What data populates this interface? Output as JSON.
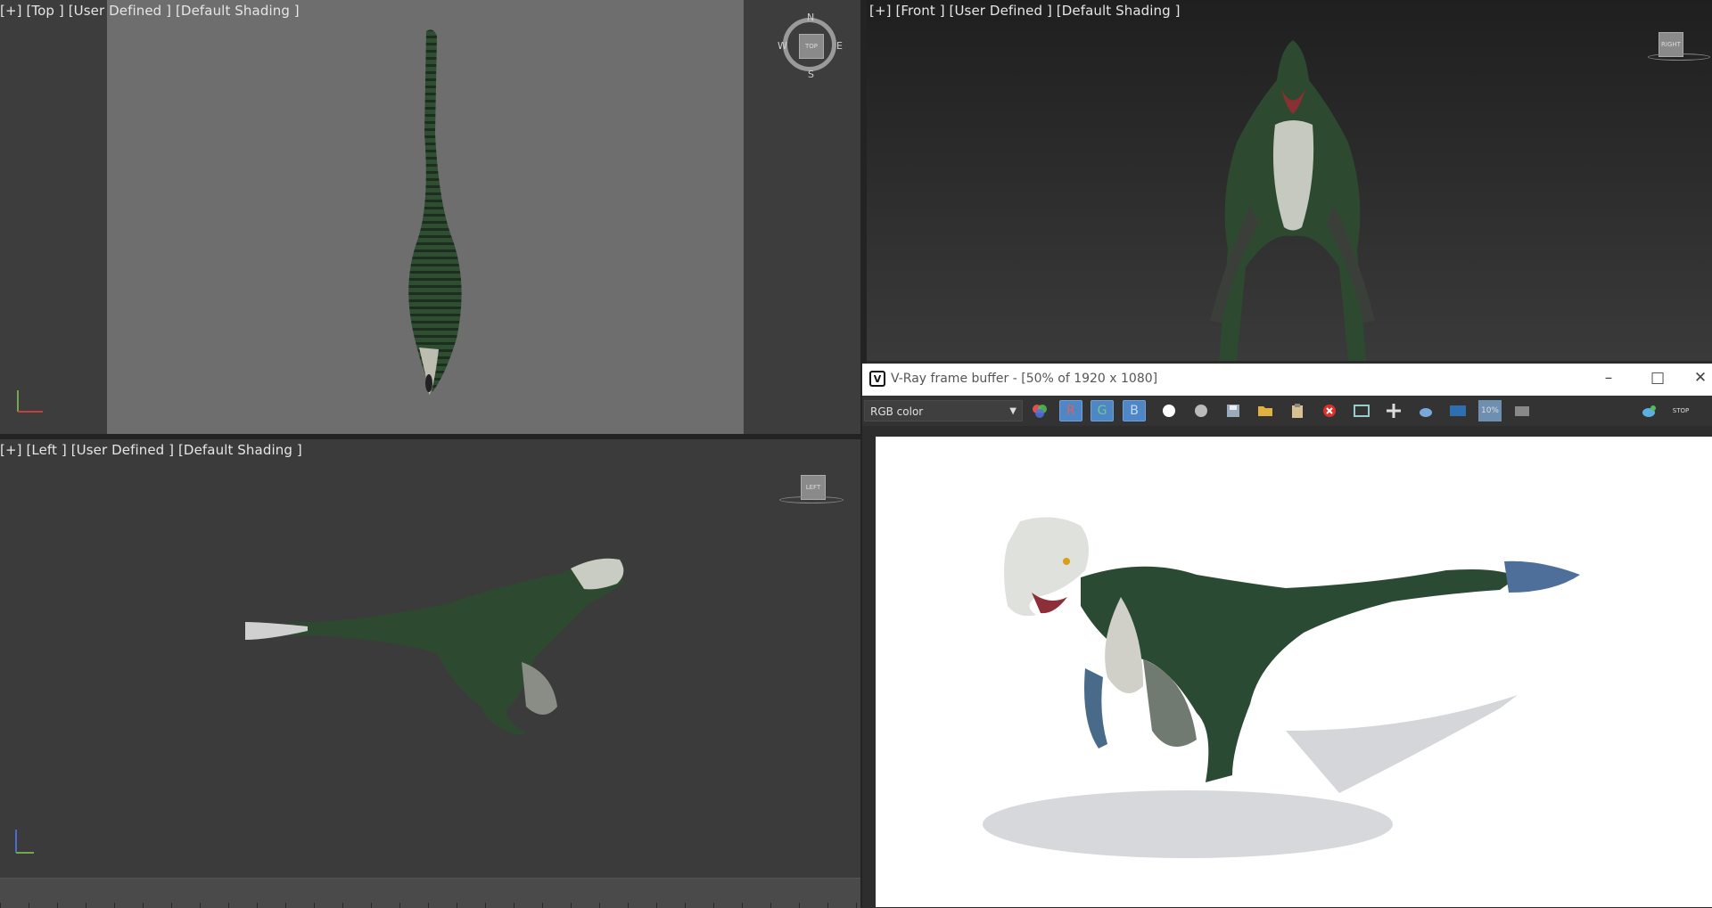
{
  "viewports": {
    "top": {
      "label": "[+] [Top ] [User Defined ] [Default Shading ]",
      "compass": {
        "n": "N",
        "s": "S",
        "e": "E",
        "w": "W",
        "cube": "TOP"
      }
    },
    "front": {
      "label": "[+] [Front ] [User Defined ] [Default Shading ]",
      "cube": "RIGHT"
    },
    "left": {
      "label": "[+] [Left ] [User Defined ] [Default Shading ]",
      "cube": "LEFT"
    }
  },
  "vfb": {
    "title": "V-Ray frame buffer - [50% of 1920 x 1080]",
    "channel": "RGB color",
    "channels": {
      "r": "R",
      "g": "G",
      "b": "B"
    },
    "icons": [
      "color-swatch-icon",
      "red-channel-icon",
      "green-channel-icon",
      "blue-channel-icon",
      "mono-white-icon",
      "mono-gray-icon",
      "save-icon",
      "open-folder-icon",
      "clipboard-icon",
      "clear-icon",
      "region-icon",
      "track-mouse-icon",
      "teapot-render-icon",
      "lens-fx-icon",
      "zoom-icon",
      "history-icon",
      "render-icon",
      "stop-icon"
    ],
    "stop_label": "STOP",
    "zoom_badge": "10%"
  },
  "colors": {
    "accent": "#4f86c6",
    "close_red": "#d9312b",
    "dino_green": "#2e4a32"
  }
}
